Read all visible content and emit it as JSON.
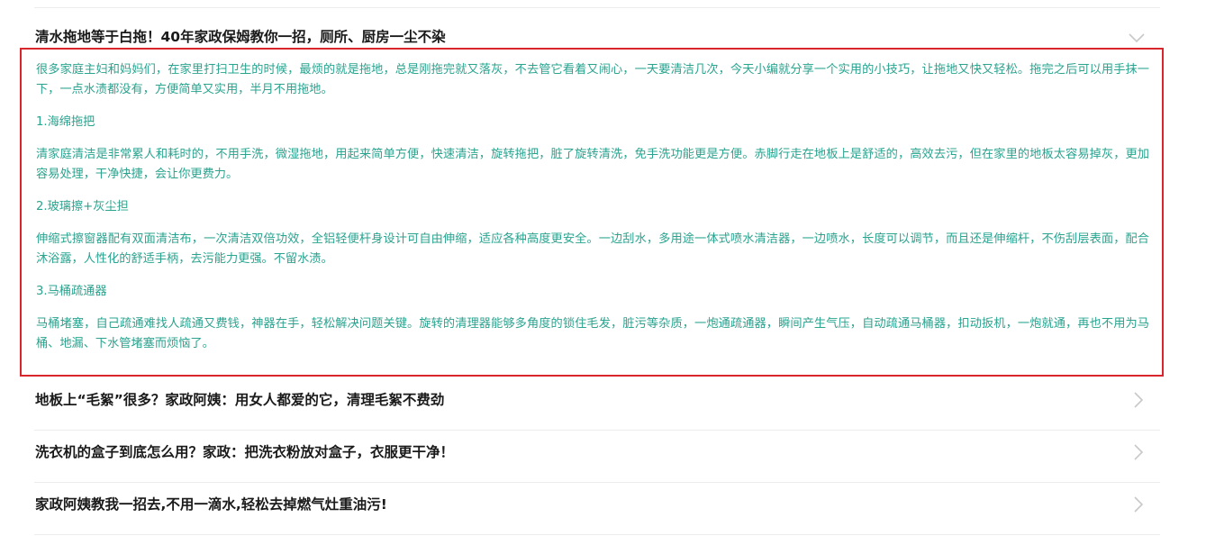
{
  "expanded_article": {
    "title": "清水拖地等于白拖！40年家政保姆教你一招，厕所、厨房一尘不染",
    "paragraphs": [
      "很多家庭主妇和妈妈们，在家里打扫卫生的时候，最烦的就是拖地，总是刚拖完就又落灰，不去管它看着又闹心，一天要清洁几次，今天小编就分享一个实用的小技巧，让拖地又快又轻松。拖完之后可以用手抹一下，一点水渍都没有，方便简单又实用，半月不用拖地。",
      "1.海绵拖把",
      "清家庭清洁是非常累人和耗时的，不用手洗，微湿拖地，用起来简单方便，快速清洁，旋转拖把，脏了旋转清洗，免手洗功能更是方便。赤脚行走在地板上是舒适的，高效去污，但在家里的地板太容易掉灰，更加容易处理，干净快捷，会让你更费力。",
      "2.玻璃擦+灰尘担",
      "伸缩式擦窗器配有双面清洁布，一次清洁双倍功效，全铝轻便杆身设计可自由伸缩，适应各种高度更安全。一边刮水，多用途一体式喷水清洁器，一边喷水，长度可以调节，而且还是伸缩杆，不伤刮层表面，配合沐浴露，人性化的舒适手柄，去污能力更强。不留水渍。",
      "3.马桶疏通器",
      "马桶堵塞，自己疏通难找人疏通又费钱，神器在手，轻松解决问题关键。旋转的清理器能够多角度的锁住毛发，脏污等杂质，一炮通疏通器，瞬间产生气压，自动疏通马桶器，扣动扳机，一炮就通，再也不用为马桶、地漏、下水管堵塞而烦恼了。"
    ]
  },
  "articles": [
    {
      "title": "地板上“毛絮”很多？家政阿姨：用女人都爱的它，清理毛絮不费劲"
    },
    {
      "title": "洗衣机的盒子到底怎么用？家政：把洗衣粉放对盒子，衣服更干净！"
    },
    {
      "title": "家政阿姨教我一招去,不用一滴水,轻松去掉燃气灶重油污!"
    }
  ],
  "icons": {
    "expand": "chevron-down-icon",
    "open": "chevron-right-icon"
  },
  "colors": {
    "content_text": "#2aa38f",
    "highlight_border": "#d9252c",
    "title_text": "#1a1a1a"
  }
}
